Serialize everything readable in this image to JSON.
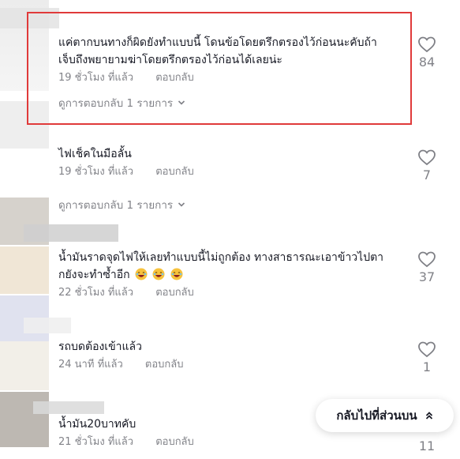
{
  "comments": [
    {
      "text_line1": "แค่ตากบนทางก็ผิดยังทำแบบนี้ โดนข้อโดยตรึกตรองไว้ก่อนนะคับถ้า",
      "text_line2": "เจ็บถึงพยายามฆ่าโดยตรึกตรองไว้ก่อนได้เลยน่ะ",
      "time": "19 ชั่วโมง ที่แล้ว",
      "reply": "ตอบกลับ",
      "view_replies": "ดูการตอบกลับ 1 รายการ",
      "likes": "84",
      "highlighted": true
    },
    {
      "text_line1": "ไฟเช็คในมือลั้น",
      "time": "19 ชั่วโมง ที่แล้ว",
      "reply": "ตอบกลับ",
      "view_replies": "ดูการตอบกลับ 1 รายการ",
      "likes": "7"
    },
    {
      "text_line1": "น้ำมันราดจุดไฟให้เลยทำแบบนี้ไม่ถูกต้อง ทางสาธารณะเอาข้าวไปตา",
      "text_line2": "กยังจะทำซ้ำอีก",
      "emoji": "laughing-face",
      "emoji_count": 3,
      "time": "22 ชั่วโมง ที่แล้ว",
      "reply": "ตอบกลับ",
      "likes": "37"
    },
    {
      "text_line1": "รถบดต้องเข้าแล้ว",
      "time": "24 นาที ที่แล้ว",
      "reply": "ตอบกลับ",
      "likes": "1"
    },
    {
      "text_line1": "น้ำมัน20บาทคับ",
      "time": "21 ชั่วโมง ที่แล้ว",
      "reply": "ตอบกลับ",
      "likes": "11"
    }
  ],
  "back_to_top": {
    "label": "กลับไปที่ส่วนบน",
    "icon": "double-chevron-up-icon"
  },
  "colors": {
    "highlight_border": "#e03a3a",
    "text_primary": "#161823",
    "text_secondary": "rgba(22,24,35,0.55)"
  }
}
